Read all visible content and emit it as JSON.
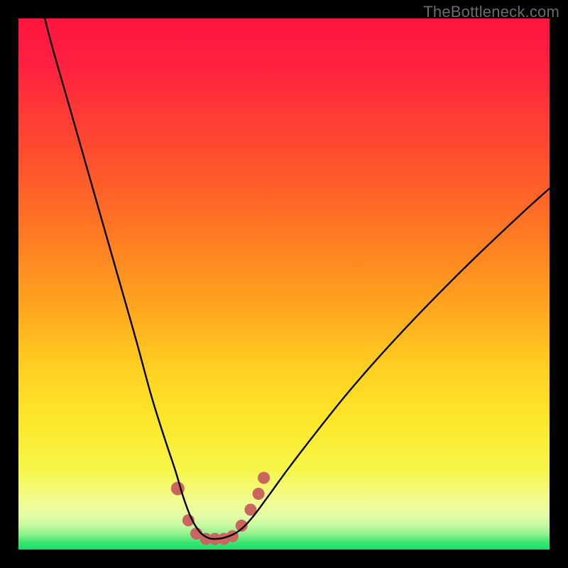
{
  "watermark": "TheBottleneck.com",
  "gradient_stops": [
    {
      "offset": 0.0,
      "color": "#ff153f"
    },
    {
      "offset": 0.08,
      "color": "#ff1f40"
    },
    {
      "offset": 0.18,
      "color": "#ff3a36"
    },
    {
      "offset": 0.3,
      "color": "#ff5a2a"
    },
    {
      "offset": 0.42,
      "color": "#ff7e22"
    },
    {
      "offset": 0.55,
      "color": "#ffa81e"
    },
    {
      "offset": 0.66,
      "color": "#ffd021"
    },
    {
      "offset": 0.76,
      "color": "#fce82a"
    },
    {
      "offset": 0.85,
      "color": "#f6f64a"
    },
    {
      "offset": 0.905,
      "color": "#f2fb8c"
    },
    {
      "offset": 0.935,
      "color": "#e6fda6"
    },
    {
      "offset": 0.955,
      "color": "#c6f9a0"
    },
    {
      "offset": 0.972,
      "color": "#8af08a"
    },
    {
      "offset": 0.986,
      "color": "#3de670"
    },
    {
      "offset": 1.0,
      "color": "#18df67"
    }
  ],
  "marker_color": "#cb6560",
  "marker_stroke": "#cb6560",
  "curve_color": "#000000",
  "chart_data": {
    "type": "line",
    "title": "",
    "xlabel": "",
    "ylabel": "",
    "xlim": [
      0,
      100
    ],
    "ylim": [
      0,
      100
    ],
    "series": [
      {
        "name": "bottleneck-curve",
        "x": [
          3,
          6,
          10,
          14,
          18,
          22,
          25,
          27.5,
          29.5,
          31,
          32.5,
          34,
          35.5,
          37,
          39,
          41.5,
          44,
          47,
          51,
          56,
          62,
          69,
          77,
          86,
          95,
          100
        ],
        "y": [
          108,
          96,
          82,
          68,
          54,
          40,
          29,
          21,
          15,
          10,
          6,
          3.5,
          2.3,
          2.0,
          2.3,
          3.5,
          6,
          10,
          15.5,
          22,
          29.5,
          37.5,
          46,
          55,
          63.5,
          68
        ]
      }
    ],
    "markers": {
      "name": "highlight-region",
      "points": [
        {
          "x": 30.0,
          "y": 11.5,
          "r": 9
        },
        {
          "x": 32.0,
          "y": 5.5,
          "r": 8
        },
        {
          "x": 33.5,
          "y": 3.0,
          "r": 8
        },
        {
          "x": 35.3,
          "y": 2.0,
          "r": 8
        },
        {
          "x": 37.0,
          "y": 2.0,
          "r": 8
        },
        {
          "x": 38.7,
          "y": 2.0,
          "r": 8
        },
        {
          "x": 40.3,
          "y": 2.5,
          "r": 8
        },
        {
          "x": 42.0,
          "y": 4.5,
          "r": 8
        },
        {
          "x": 43.7,
          "y": 7.5,
          "r": 8
        },
        {
          "x": 45.2,
          "y": 10.5,
          "r": 8
        },
        {
          "x": 46.2,
          "y": 13.5,
          "r": 8
        }
      ]
    }
  }
}
